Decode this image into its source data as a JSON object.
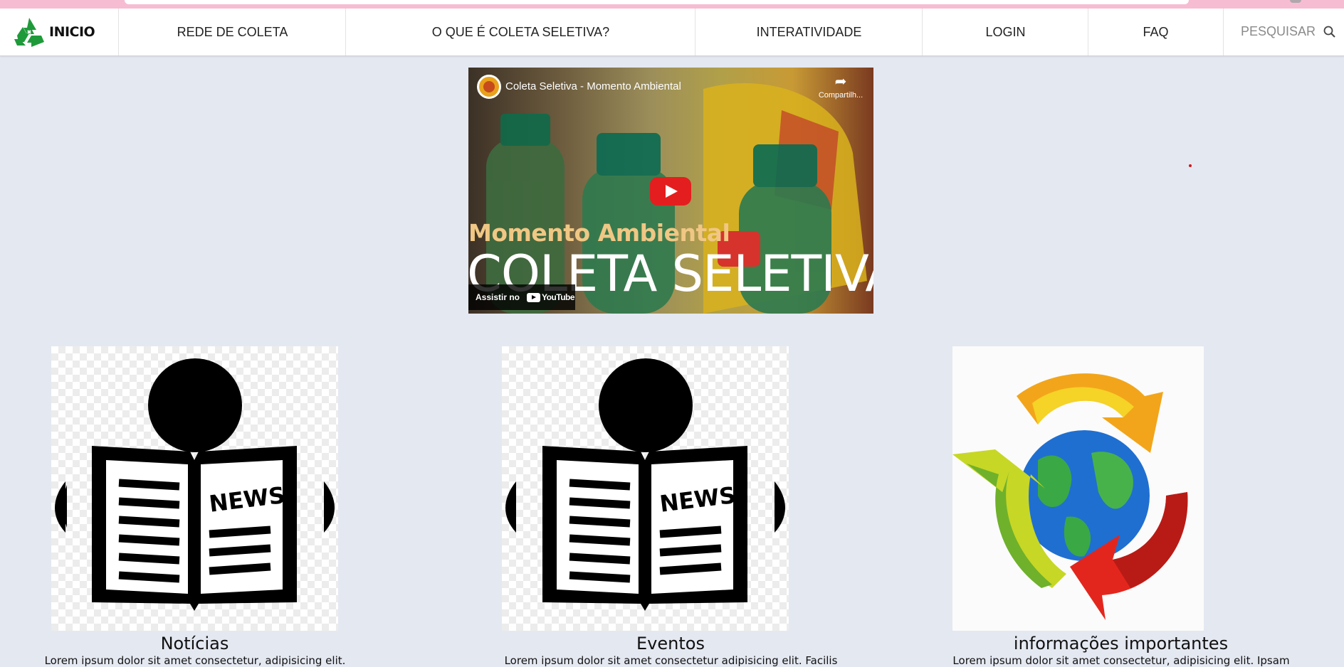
{
  "colors": {
    "page_background": "#e4e8f1",
    "browser_strip": "#f6bdd2",
    "navbar_background": "#ffffff",
    "youtube_red": "#e41e1e",
    "recycle_green": "#1f9a3a"
  },
  "navbar": {
    "brand": {
      "label": "INICIO",
      "icon": "recycle-logo-icon"
    },
    "items": [
      {
        "label": "REDE DE COLETA"
      },
      {
        "label": "O QUE É COLETA SELETIVA?"
      },
      {
        "label": "INTERATIVIDADE"
      },
      {
        "label": "LOGIN"
      },
      {
        "label": "FAQ"
      }
    ],
    "search": {
      "label": "PESQUISAR",
      "icon": "search-icon"
    }
  },
  "video": {
    "title": "Coleta Seletiva - Momento Ambiental",
    "share_label": "Compartilh...",
    "overlay_subtitle": "Momento Ambiental",
    "overlay_title": "COLETA SELETIVA",
    "watch_label": "Assistir no",
    "platform_label": "YouTube",
    "icons": [
      "channel-avatar-icon",
      "share-icon",
      "play-icon",
      "youtube-logo-icon"
    ]
  },
  "cards": [
    {
      "image": "newspaper-reader-icon",
      "image_text": "NEWS",
      "title": "Notícias",
      "text": "Lorem ipsum dolor sit amet consectetur, adipisicing elit."
    },
    {
      "image": "newspaper-reader-icon",
      "image_text": "NEWS",
      "title": "Eventos",
      "text": "Lorem ipsum dolor sit amet consectetur adipisicing elit. Facilis"
    },
    {
      "image": "recycle-globe-icon",
      "title": "informações importantes",
      "text": "Lorem ipsum dolor sit amet consectetur, adipisicing elit. Ipsam"
    }
  ]
}
